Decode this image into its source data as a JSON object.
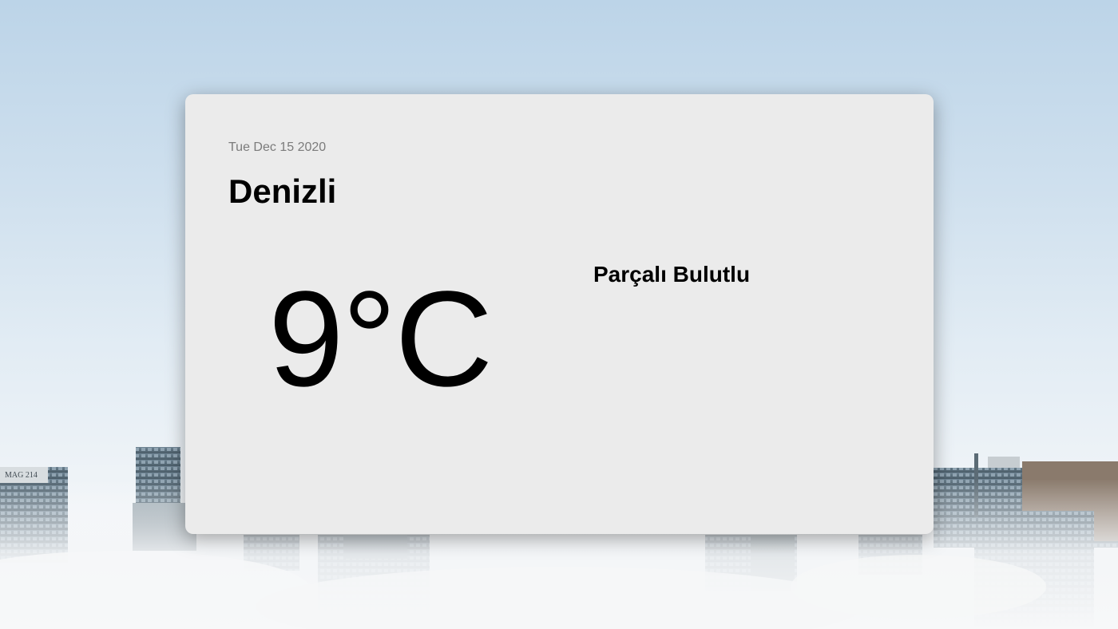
{
  "weather": {
    "date": "Tue Dec 15 2020",
    "city": "Denizli",
    "temperature": "9°C",
    "condition": "Parçalı Bulutlu"
  },
  "background": {
    "building_sign": "MAG 214"
  }
}
